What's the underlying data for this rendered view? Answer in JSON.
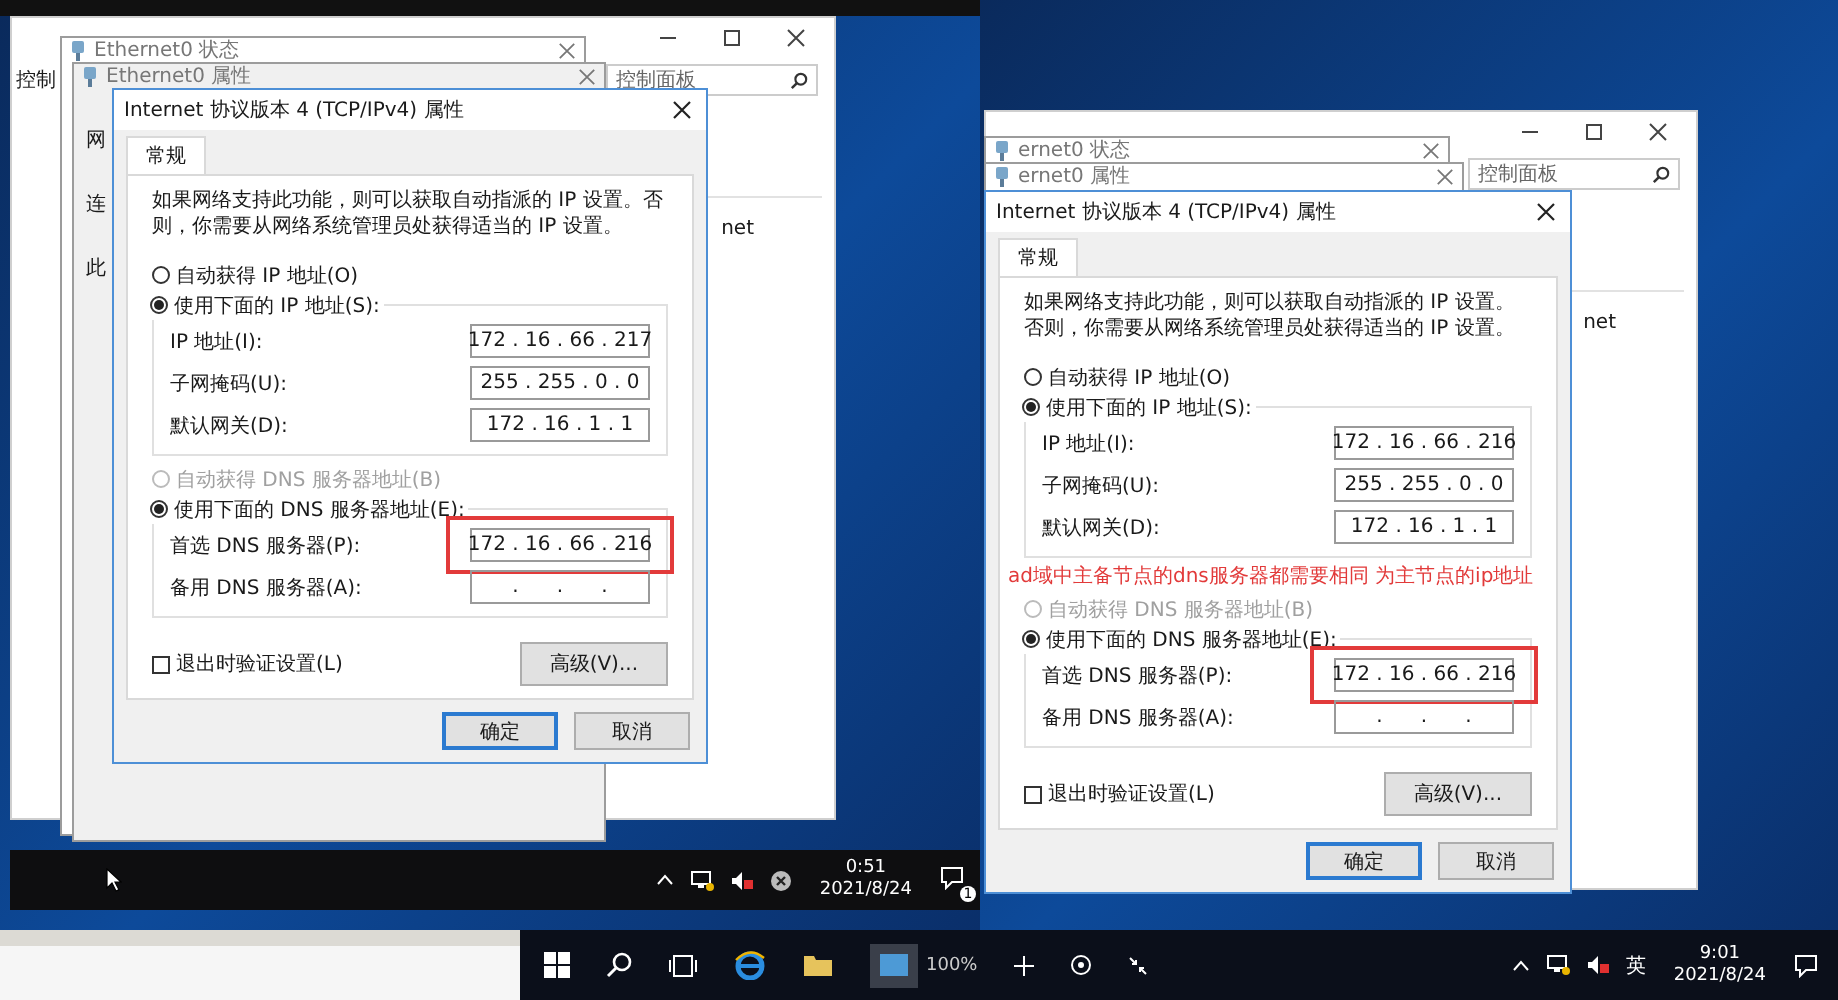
{
  "screens": [
    {
      "control_panel": {
        "label": "控制",
        "search_placeholder": "控制面板",
        "side_text": "net"
      },
      "back_windows": [
        {
          "title": "Ethernet0 状态"
        },
        {
          "title": "Ethernet0 属性",
          "fragments": [
            "网",
            "连",
            "此"
          ]
        }
      ],
      "dialog": {
        "title": "Internet 协议版本 4 (TCP/IPv4) 属性",
        "tabs": [
          {
            "label": "常规",
            "selected": true
          }
        ],
        "description": "如果网络支持此功能，则可以获取自动指派的 IP 设置。否则，你需要从网络系统管理员处获得适当的 IP 设置。",
        "ip_options": [
          {
            "label": "自动获得 IP 地址(O)",
            "selected": false,
            "disabled": false
          },
          {
            "label": "使用下面的 IP 地址(S):",
            "selected": true,
            "disabled": false
          }
        ],
        "ip_fields": [
          {
            "label": "IP 地址(I):",
            "value": "172 . 16 . 66 . 217",
            "highlighted": false
          },
          {
            "label": "子网掩码(U):",
            "value": "255 . 255 . 0 . 0",
            "highlighted": false
          },
          {
            "label": "默认网关(D):",
            "value": "172 . 16 . 1 . 1",
            "highlighted": false
          }
        ],
        "dns_options": [
          {
            "label": "自动获得 DNS 服务器地址(B)",
            "selected": false,
            "disabled": true
          },
          {
            "label": "使用下面的 DNS 服务器地址(E):",
            "selected": true,
            "disabled": false
          }
        ],
        "dns_fields": [
          {
            "label": "首选 DNS 服务器(P):",
            "value": "172 . 16 . 66 . 216",
            "highlighted": true
          },
          {
            "label": "备用 DNS 服务器(A):",
            "value": ".      .      .",
            "highlighted": false
          }
        ],
        "validate_checkbox": {
          "label": "退出时验证设置(L)",
          "checked": false
        },
        "advanced_button": "高级(V)...",
        "buttons": [
          {
            "label": "确定",
            "default": true
          },
          {
            "label": "取消",
            "default": false
          }
        ]
      },
      "taskbar": {
        "kind": "compact",
        "time": "0:51",
        "date": "2021/8/24",
        "notification_count": "1"
      }
    },
    {
      "control_panel": {
        "search_placeholder": "控制面板",
        "side_text": "net"
      },
      "back_windows": [
        {
          "title": "ernet0 状态"
        },
        {
          "title": "ernet0 属性"
        }
      ],
      "dialog": {
        "title": "Internet 协议版本 4 (TCP/IPv4) 属性",
        "tabs": [
          {
            "label": "常规",
            "selected": true
          }
        ],
        "description": "如果网络支持此功能，则可以获取自动指派的 IP 设置。否则，你需要从网络系统管理员处获得适当的 IP 设置。",
        "ip_options": [
          {
            "label": "自动获得 IP 地址(O)",
            "selected": false,
            "disabled": false
          },
          {
            "label": "使用下面的 IP 地址(S):",
            "selected": true,
            "disabled": false
          }
        ],
        "ip_fields": [
          {
            "label": "IP 地址(I):",
            "value": "172 . 16 . 66 . 216",
            "highlighted": false
          },
          {
            "label": "子网掩码(U):",
            "value": "255 . 255 . 0 . 0",
            "highlighted": false
          },
          {
            "label": "默认网关(D):",
            "value": "172 . 16 . 1 . 1",
            "highlighted": false
          }
        ],
        "annotation": "ad域中主备节点的dns服务器都需要相同 为主节点的ip地址",
        "dns_options": [
          {
            "label": "自动获得 DNS 服务器地址(B)",
            "selected": false,
            "disabled": true
          },
          {
            "label": "使用下面的 DNS 服务器地址(E):",
            "selected": true,
            "disabled": false
          }
        ],
        "dns_fields": [
          {
            "label": "首选 DNS 服务器(P):",
            "value": "172 . 16 . 66 . 216",
            "highlighted": true
          },
          {
            "label": "备用 DNS 服务器(A):",
            "value": ".      .      .",
            "highlighted": false
          }
        ],
        "validate_checkbox": {
          "label": "退出时验证设置(L)",
          "checked": false
        },
        "advanced_button": "高级(V)...",
        "buttons": [
          {
            "label": "确定",
            "default": true
          },
          {
            "label": "取消",
            "default": false
          }
        ]
      },
      "taskbar": {
        "kind": "full",
        "zoom": "100%",
        "ime": "英",
        "time": "9:01",
        "date": "2021/8/24"
      }
    }
  ]
}
